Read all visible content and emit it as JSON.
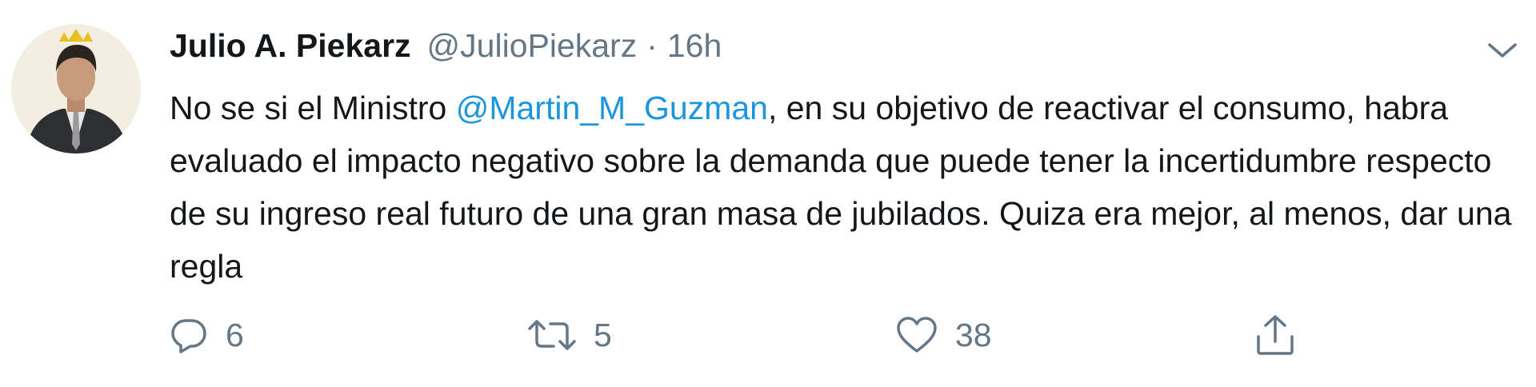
{
  "author": {
    "display_name": "Julio A. Piekarz",
    "handle": "@JulioPiekarz",
    "separator": "·",
    "time": "16h",
    "avatar_icon": "profile-photo"
  },
  "tweet": {
    "text_before": "No se si el Ministro ",
    "mention": "@Martin_M_Guzman",
    "text_after": ", en su objetivo de reactivar el consumo, habra evaluado el impacto negativo sobre la demanda que puede tener la incertidumbre respecto de su ingreso real futuro de una gran masa de jubilados. Quiza era mejor, al menos, dar una regla"
  },
  "actions": {
    "reply_count": "6",
    "retweet_count": "5",
    "like_count": "38"
  },
  "colors": {
    "text": "#14171a",
    "secondary": "#657786",
    "link": "#1b95e0",
    "background": "#ffffff"
  }
}
